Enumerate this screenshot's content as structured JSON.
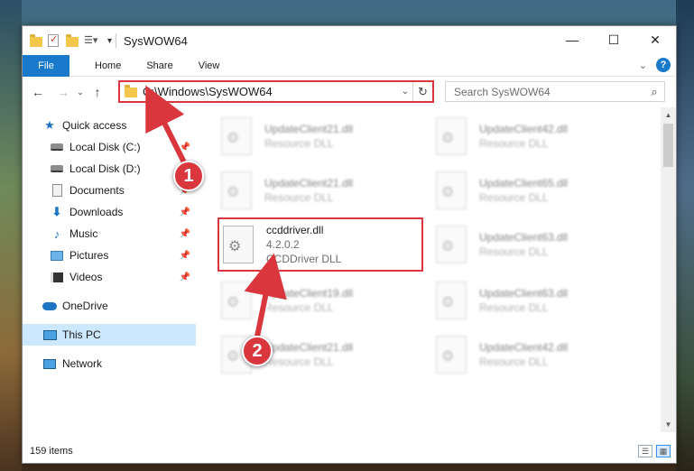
{
  "window": {
    "title": "SysWOW64"
  },
  "controls": {
    "minimize": "—",
    "maximize": "☐",
    "close": "✕"
  },
  "ribbon": {
    "tabs": [
      "File",
      "Home",
      "Share",
      "View"
    ],
    "help": "?"
  },
  "nav": {
    "back": "←",
    "forward": "→",
    "recent": "⌄",
    "up": "↑"
  },
  "address": {
    "path": "C:\\Windows\\SysWOW64",
    "refresh": "↻"
  },
  "search": {
    "placeholder": "Search SysWOW64"
  },
  "sidebar": {
    "items": [
      {
        "label": "Quick access",
        "pinned": false
      },
      {
        "label": "Local Disk (C:)",
        "pinned": true
      },
      {
        "label": "Local Disk (D:)",
        "pinned": false
      },
      {
        "label": "Documents",
        "pinned": true
      },
      {
        "label": "Downloads",
        "pinned": true
      },
      {
        "label": "Music",
        "pinned": true
      },
      {
        "label": "Pictures",
        "pinned": true
      },
      {
        "label": "Videos",
        "pinned": true
      },
      {
        "label": "OneDrive",
        "pinned": false
      },
      {
        "label": "This PC",
        "pinned": false,
        "selected": true
      },
      {
        "label": "Network",
        "pinned": false
      }
    ]
  },
  "files": [
    {
      "name": "UpdateClient21.dll",
      "type": "Resource DLL",
      "blurred": true
    },
    {
      "name": "UpdateClient42.dll",
      "type": "Resource DLL",
      "blurred": true
    },
    {
      "name": "UpdateClient21.dll",
      "type": "Resource DLL",
      "blurred": true
    },
    {
      "name": "UpdateClient65.dll",
      "type": "Resource DLL",
      "blurred": true
    },
    {
      "name": "ccddriver.dll",
      "version": "4.2.0.2",
      "type": "CCDDriver DLL",
      "blurred": false,
      "highlighted": true
    },
    {
      "name": "UpdateClient63.dll",
      "type": "Resource DLL",
      "blurred": true
    },
    {
      "name": "UpdateClient19.dll",
      "type": "Resource DLL",
      "blurred": true
    },
    {
      "name": "UpdateClient63.dll",
      "type": "Resource DLL",
      "blurred": true
    },
    {
      "name": "UpdateClient21.dll",
      "type": "Resource DLL",
      "blurred": true
    },
    {
      "name": "UpdateClient42.dll",
      "type": "Resource DLL",
      "blurred": true
    }
  ],
  "status": {
    "item_count": "159 items"
  },
  "annotations": {
    "step1": "1",
    "step2": "2",
    "color": "#d9363e"
  }
}
